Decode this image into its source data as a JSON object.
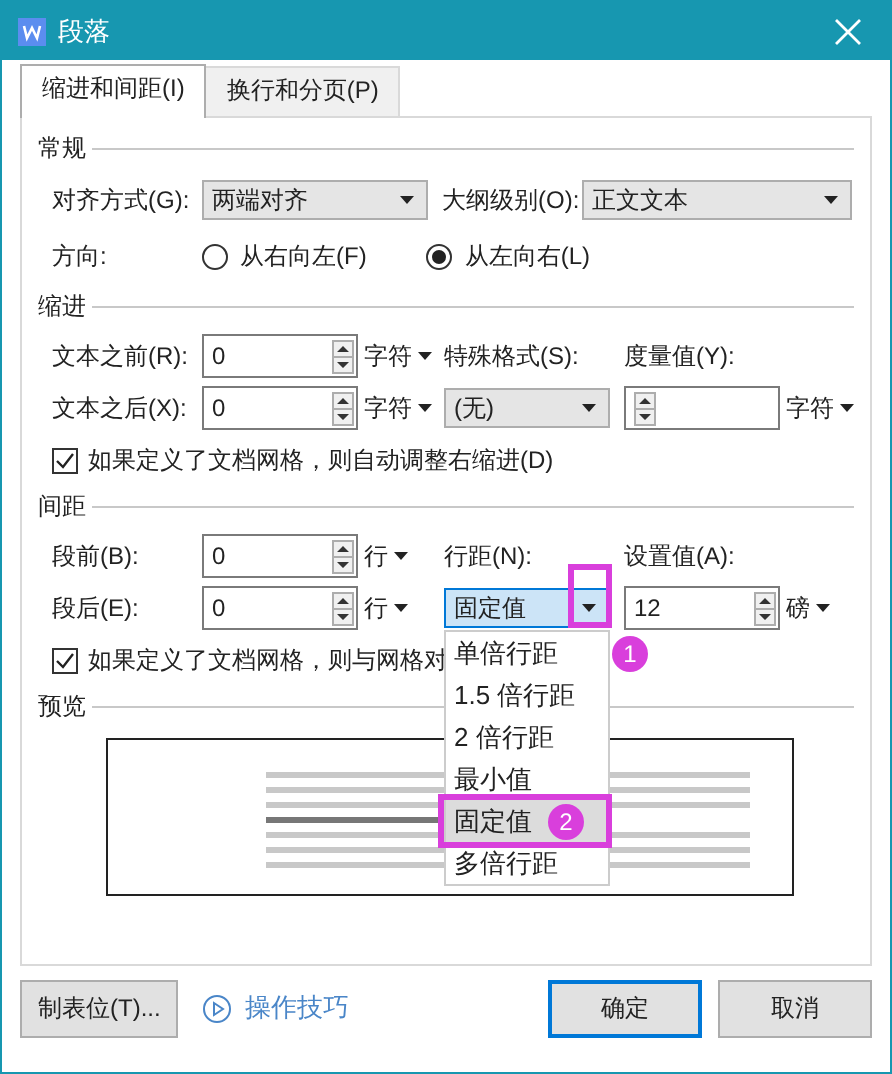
{
  "window": {
    "title": "段落"
  },
  "tabs": [
    {
      "label": "缩进和间距(I)",
      "selected": true
    },
    {
      "label": "换行和分页(P)",
      "selected": false
    }
  ],
  "general": {
    "title": "常规",
    "alignment": {
      "label": "对齐方式(G):",
      "value": "两端对齐"
    },
    "outline_level": {
      "label": "大纲级别(O):",
      "value": "正文文本"
    },
    "direction": {
      "label": "方向:",
      "options": [
        {
          "label": "从右向左(F)",
          "selected": false
        },
        {
          "label": "从左向右(L)",
          "selected": true
        }
      ]
    }
  },
  "indent": {
    "title": "缩进",
    "before": {
      "label": "文本之前(R):",
      "value": "0",
      "unit": "字符"
    },
    "after": {
      "label": "文本之后(X):",
      "value": "0",
      "unit": "字符"
    },
    "special": {
      "label": "特殊格式(S):",
      "value": "(无)"
    },
    "measure": {
      "label": "度量值(Y):",
      "unit": "字符"
    },
    "auto_adjust": {
      "label": "如果定义了文档网格，则自动调整右缩进(D)",
      "checked": true
    }
  },
  "spacing": {
    "title": "间距",
    "before": {
      "label": "段前(B):",
      "value": "0",
      "unit": "行"
    },
    "after": {
      "label": "段后(E):",
      "value": "0",
      "unit": "行"
    },
    "line_spacing": {
      "label": "行距(N):",
      "value": "固定值",
      "focused": true,
      "expanded": true,
      "annotation": "1",
      "options": [
        {
          "label": "单倍行距",
          "selected": false
        },
        {
          "label": "1.5 倍行距",
          "selected": false
        },
        {
          "label": "2 倍行距",
          "selected": false
        },
        {
          "label": "最小值",
          "selected": false
        },
        {
          "label": "固定值",
          "selected": true,
          "annotation": "2"
        },
        {
          "label": "多倍行距",
          "selected": false
        }
      ]
    },
    "set_value": {
      "label": "设置值(A):",
      "value": "12",
      "unit": "磅"
    },
    "snap_to_grid": {
      "label": "如果定义了文档网格，则与网格对",
      "checked": true
    }
  },
  "preview": {
    "title": "预览"
  },
  "footer": {
    "tabs_button": "制表位(T)...",
    "tips_link": "操作技巧",
    "buttons": [
      {
        "label": "确定",
        "default": true
      },
      {
        "label": "取消",
        "default": false
      }
    ]
  }
}
